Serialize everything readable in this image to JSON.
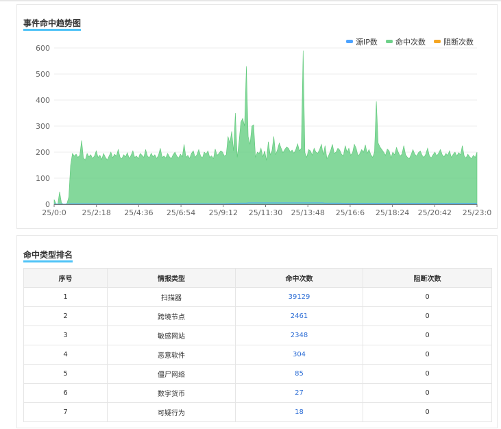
{
  "trend_panel": {
    "title": "事件命中趋势图"
  },
  "type_panel": {
    "title": "命中类型排名"
  },
  "chart_data": {
    "type": "area",
    "title": "事件命中趋势图",
    "legend": [
      "源IP数",
      "命中次数",
      "阻断次数"
    ],
    "legend_position": "top-right",
    "colors": {
      "源IP数": "#4da3ff",
      "命中次数": "#6fd18a",
      "阻断次数": "#f5a623"
    },
    "ylim": [
      0,
      600
    ],
    "y_ticks": [
      0,
      100,
      200,
      300,
      400,
      500,
      600
    ],
    "x_tick_labels": [
      "25/0:0",
      "25/2:18",
      "25/4:36",
      "25/6:54",
      "25/9:12",
      "25/11:30",
      "25/13:48",
      "25/16:6",
      "25/18:24",
      "25/20:42",
      "25/23:0"
    ],
    "grid": true,
    "series": [
      {
        "name": "命中次数",
        "values": [
          18,
          2,
          0,
          48,
          5,
          0,
          0,
          3,
          28,
          150,
          195,
          185,
          192,
          180,
          188,
          245,
          178,
          170,
          195,
          182,
          190,
          176,
          185,
          205,
          180,
          188,
          172,
          195,
          180,
          170,
          185,
          200,
          178,
          192,
          185,
          210,
          180,
          175,
          190,
          182,
          198,
          176,
          188,
          205,
          180,
          185,
          175,
          195,
          188,
          180,
          210,
          185,
          178,
          196,
          182,
          190,
          176,
          188,
          215,
          180,
          185,
          178,
          195,
          182,
          175,
          190,
          200,
          185,
          178,
          192,
          182,
          230,
          180,
          188,
          176,
          195,
          205,
          180,
          190,
          210,
          185,
          178,
          200,
          192,
          205,
          180,
          186,
          175,
          212,
          188,
          195,
          205,
          200,
          185,
          190,
          260,
          235,
          280,
          205,
          350,
          180,
          240,
          315,
          330,
          300,
          530,
          260,
          230,
          300,
          305,
          180,
          200,
          195,
          215,
          182,
          205,
          168,
          240,
          190,
          205,
          260,
          190,
          210,
          235,
          215,
          198,
          210,
          220,
          215,
          200,
          208,
          196,
          210,
          232,
          205,
          215,
          590,
          198,
          180,
          210,
          205,
          188,
          215,
          200,
          196,
          210,
          230,
          190,
          225,
          175,
          188,
          205,
          230,
          195,
          200,
          215,
          208,
          192,
          185,
          225,
          200,
          215,
          188,
          198,
          230,
          215,
          185,
          195,
          210,
          200,
          228,
          195,
          210,
          190,
          180,
          200,
          395,
          235,
          220,
          210,
          200,
          188,
          212,
          205,
          178,
          200,
          190,
          218,
          200,
          185,
          192,
          225,
          190,
          180,
          175,
          190,
          210,
          192,
          185,
          198,
          205,
          188,
          180,
          192,
          215,
          185,
          178,
          190,
          200,
          185,
          196,
          210,
          190,
          182,
          195,
          188,
          205,
          180,
          192,
          200,
          185,
          198,
          190,
          225,
          185,
          178,
          192,
          182,
          175,
          188,
          180,
          200
        ]
      },
      {
        "name": "源IP数",
        "values": [
          0,
          0,
          0,
          0,
          0,
          0,
          0,
          0,
          0,
          1,
          1,
          1,
          1,
          1,
          1,
          1,
          1,
          1,
          1,
          1,
          1,
          1,
          1,
          1,
          1,
          1,
          1,
          1,
          1,
          1,
          1,
          1,
          1,
          1,
          1,
          1,
          1,
          1,
          1,
          1,
          1,
          1,
          1,
          1,
          1,
          1,
          1,
          1,
          1,
          1,
          1,
          1,
          1,
          1,
          1,
          1,
          1,
          1,
          1,
          1,
          1,
          1,
          1,
          1,
          1,
          1,
          1,
          1,
          1,
          1,
          1,
          1,
          1,
          1,
          1,
          1,
          1,
          1,
          1,
          1,
          1,
          1,
          1,
          1,
          1,
          1,
          1,
          1,
          1,
          1,
          1,
          1,
          1,
          1,
          1,
          2,
          2,
          3,
          3,
          3,
          3,
          3,
          4,
          4,
          4,
          4,
          4,
          5,
          5,
          5,
          5,
          5,
          5,
          5,
          5,
          5,
          5,
          5,
          5,
          5,
          5,
          5,
          5,
          5,
          5,
          5,
          5,
          5,
          5,
          5,
          5,
          5,
          5,
          5,
          5,
          5,
          5,
          5,
          5,
          5,
          5,
          5,
          5,
          5,
          5,
          5,
          5,
          5,
          5,
          4,
          4,
          4,
          4,
          4,
          4,
          4,
          4,
          4,
          4,
          3,
          3,
          3,
          3,
          3,
          3,
          3,
          3,
          3,
          3,
          3,
          3,
          3,
          3,
          3,
          3,
          3,
          3,
          3,
          3,
          3,
          3,
          3,
          3,
          3,
          3,
          3,
          3,
          3,
          3,
          3,
          3,
          3,
          3,
          3,
          3,
          3,
          3,
          3,
          3,
          3,
          3,
          3,
          3,
          3,
          3,
          3,
          3,
          3,
          3,
          3,
          3,
          3,
          3,
          3,
          3,
          3,
          3,
          3,
          3,
          3,
          3,
          3,
          3,
          3,
          3,
          3,
          3,
          3,
          3,
          3,
          3,
          3,
          3,
          3
        ]
      },
      {
        "name": "阻断次数",
        "values": [
          0
        ]
      }
    ]
  },
  "rank_table": {
    "headers": [
      "序号",
      "情报类型",
      "命中次数",
      "阻断次数"
    ],
    "rows": [
      [
        "1",
        "扫描器",
        "39129",
        "0"
      ],
      [
        "2",
        "跨境节点",
        "2461",
        "0"
      ],
      [
        "3",
        "敏感网站",
        "2348",
        "0"
      ],
      [
        "4",
        "恶意软件",
        "304",
        "0"
      ],
      [
        "5",
        "僵尸网络",
        "85",
        "0"
      ],
      [
        "6",
        "数字货币",
        "27",
        "0"
      ],
      [
        "7",
        "可疑行为",
        "18",
        "0"
      ]
    ]
  }
}
